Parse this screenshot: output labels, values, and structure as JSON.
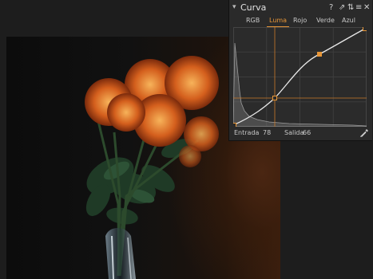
{
  "panel": {
    "title": "Curva",
    "collapse_icon": "chevron-down-icon",
    "header_icons": [
      "help-icon",
      "pin-icon",
      "presets-icon",
      "menu-icon",
      "close-icon"
    ],
    "header_glyphs": [
      "?",
      "⇗",
      "⇅",
      "≡",
      "✕"
    ]
  },
  "tabs": [
    {
      "label": "RGB",
      "active": false
    },
    {
      "label": "Luma",
      "active": true
    },
    {
      "label": "Rojo",
      "active": false
    },
    {
      "label": "Verde",
      "active": false
    },
    {
      "label": "Azul",
      "active": false
    }
  ],
  "readout": {
    "input_label": "Entrada",
    "input_value": "78",
    "output_label": "Salida",
    "output_value": "66",
    "picker_icon": "eyedropper-icon"
  },
  "colors": {
    "accent": "#e79638",
    "panel_bg": "#2a2a2a",
    "curve": "#e8e8e8",
    "histogram": "#7a7a7a"
  }
}
